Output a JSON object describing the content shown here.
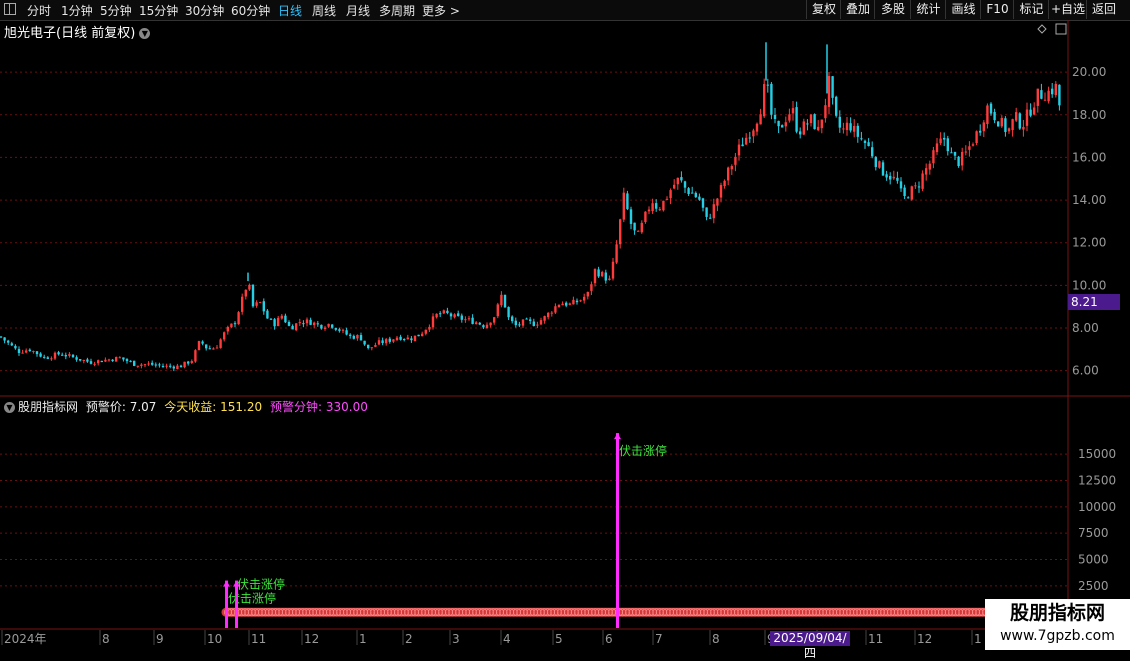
{
  "toolbar": {
    "periods": [
      "分时",
      "1分钟",
      "5分钟",
      "15分钟",
      "30分钟",
      "60分钟",
      "日线",
      "周线",
      "月线",
      "多周期",
      "更多 >"
    ],
    "active_period": "日线",
    "right_buttons": [
      "复权",
      "叠加",
      "多股",
      "统计",
      "画线",
      "F10",
      "标记",
      "+自选",
      "返回"
    ]
  },
  "stock": {
    "title": "旭光电子(日线 前复权)"
  },
  "indicator": {
    "name": "股朋指标网",
    "warn_price_label": "预警价:",
    "warn_price": "7.07",
    "today_gain_label": "今天收益:",
    "today_gain": "151.20",
    "warn_minute_label": "预警分钟:",
    "warn_minute": "330.00"
  },
  "current_price_tag": "8.21",
  "crosshair_date": "2025/09/04/四",
  "watermark": {
    "line1": "股朋指标网",
    "line2": "www.7gpzb.com"
  },
  "colors": {
    "up": "#ff3b3b",
    "down": "#24d0e6",
    "signal": "#ff2bff",
    "signal_text": "#3ce63c",
    "grid": "#6b1010",
    "axis": "#9a9a9a",
    "bead": "#d23a3a",
    "highlight": "#4b1a8c"
  },
  "chart_data": [
    {
      "type": "candlestick",
      "title": "旭光电子(日线 前复权)",
      "y_ticks": [
        6.0,
        8.0,
        10.0,
        12.0,
        14.0,
        16.0,
        18.0,
        20.0
      ],
      "ylim": [
        5.0,
        21.6
      ],
      "x_labels": [
        "2024年",
        "8",
        "9",
        "10",
        "11",
        "12",
        "1",
        "2",
        "3",
        "4",
        "5",
        "6",
        "7",
        "8",
        "9",
        "10",
        "11",
        "12",
        "1"
      ],
      "close_path": [
        [
          0,
          7.6
        ],
        [
          8,
          7.3
        ],
        [
          18,
          6.9
        ],
        [
          30,
          7.0
        ],
        [
          45,
          6.6
        ],
        [
          60,
          6.8
        ],
        [
          75,
          6.6
        ],
        [
          90,
          6.4
        ],
        [
          105,
          6.5
        ],
        [
          120,
          6.6
        ],
        [
          135,
          6.3
        ],
        [
          150,
          6.3
        ],
        [
          165,
          6.2
        ],
        [
          180,
          6.2
        ],
        [
          192,
          6.5
        ],
        [
          200,
          7.4
        ],
        [
          208,
          7.0
        ],
        [
          216,
          7.1
        ],
        [
          225,
          7.8
        ],
        [
          235,
          8.3
        ],
        [
          242,
          9.3
        ],
        [
          248,
          10.2
        ],
        [
          253,
          9.0
        ],
        [
          260,
          9.2
        ],
        [
          268,
          8.4
        ],
        [
          275,
          8.2
        ],
        [
          282,
          8.6
        ],
        [
          290,
          8.0
        ],
        [
          300,
          8.3
        ],
        [
          310,
          8.3
        ],
        [
          320,
          8.1
        ],
        [
          330,
          8.2
        ],
        [
          340,
          7.9
        ],
        [
          350,
          7.6
        ],
        [
          360,
          7.6
        ],
        [
          368,
          7.0
        ],
        [
          378,
          7.3
        ],
        [
          388,
          7.4
        ],
        [
          398,
          7.6
        ],
        [
          410,
          7.5
        ],
        [
          420,
          7.7
        ],
        [
          428,
          8.1
        ],
        [
          436,
          8.6
        ],
        [
          445,
          8.7
        ],
        [
          455,
          8.5
        ],
        [
          465,
          8.4
        ],
        [
          475,
          8.3
        ],
        [
          485,
          8.1
        ],
        [
          495,
          8.6
        ],
        [
          502,
          9.6
        ],
        [
          508,
          8.5
        ],
        [
          515,
          8.1
        ],
        [
          525,
          8.3
        ],
        [
          535,
          8.2
        ],
        [
          545,
          8.5
        ],
        [
          553,
          8.9
        ],
        [
          560,
          9.2
        ],
        [
          570,
          9.1
        ],
        [
          580,
          9.3
        ],
        [
          588,
          9.6
        ],
        [
          595,
          10.7
        ],
        [
          602,
          10.5
        ],
        [
          610,
          10.2
        ],
        [
          617,
          12.0
        ],
        [
          624,
          14.2
        ],
        [
          630,
          13.0
        ],
        [
          637,
          12.2
        ],
        [
          645,
          13.2
        ],
        [
          652,
          14.0
        ],
        [
          658,
          13.6
        ],
        [
          665,
          14.0
        ],
        [
          672,
          14.6
        ],
        [
          679,
          15.0
        ],
        [
          686,
          14.5
        ],
        [
          693,
          14.3
        ],
        [
          700,
          14.0
        ],
        [
          707,
          13.0
        ],
        [
          713,
          13.6
        ],
        [
          720,
          14.4
        ],
        [
          727,
          15.2
        ],
        [
          733,
          15.8
        ],
        [
          740,
          16.5
        ],
        [
          747,
          17.0
        ],
        [
          754,
          17.5
        ],
        [
          760,
          18.2
        ],
        [
          766,
          19.6
        ],
        [
          772,
          17.8
        ],
        [
          778,
          17.2
        ],
        [
          785,
          17.8
        ],
        [
          792,
          18.3
        ],
        [
          798,
          17.2
        ],
        [
          805,
          17.5
        ],
        [
          812,
          17.8
        ],
        [
          818,
          17.2
        ],
        [
          825,
          18.5
        ],
        [
          829,
          19.5
        ],
        [
          835,
          17.8
        ],
        [
          842,
          17.2
        ],
        [
          849,
          17.6
        ],
        [
          856,
          17.1
        ],
        [
          863,
          16.8
        ],
        [
          870,
          16.4
        ],
        [
          877,
          15.7
        ],
        [
          884,
          15.3
        ],
        [
          891,
          15.1
        ],
        [
          898,
          14.8
        ],
        [
          903,
          14.0
        ],
        [
          910,
          14.4
        ],
        [
          917,
          14.6
        ],
        [
          924,
          15.3
        ],
        [
          931,
          15.8
        ],
        [
          938,
          16.6
        ],
        [
          945,
          16.9
        ],
        [
          952,
          16.0
        ],
        [
          959,
          15.8
        ],
        [
          966,
          16.2
        ],
        [
          973,
          16.8
        ],
        [
          980,
          17.4
        ],
        [
          987,
          18.4
        ],
        [
          994,
          18.0
        ],
        [
          1001,
          17.6
        ],
        [
          1008,
          17.2
        ],
        [
          1015,
          17.9
        ],
        [
          1022,
          17.5
        ],
        [
          1030,
          18.2
        ],
        [
          1037,
          18.9
        ],
        [
          1044,
          19.0
        ],
        [
          1050,
          19.1
        ],
        [
          1056,
          19.3
        ],
        [
          1062,
          17.8
        ]
      ],
      "spikes": [
        [
          248,
          10.6
        ],
        [
          766,
          21.4
        ],
        [
          827,
          21.3
        ]
      ]
    },
    {
      "type": "bar",
      "y_ticks": [
        2500,
        5000,
        7500,
        10000,
        12500,
        15000
      ],
      "ylim": [
        -1500,
        19000
      ],
      "signals": [
        {
          "x": 226,
          "value": 3000,
          "label": "伏击涨停"
        },
        {
          "x": 236,
          "value": 3000,
          "label": "伏击涨停"
        },
        {
          "x": 617,
          "value": 17000,
          "label": "伏击涨停"
        }
      ],
      "baseline_value": 0
    }
  ]
}
